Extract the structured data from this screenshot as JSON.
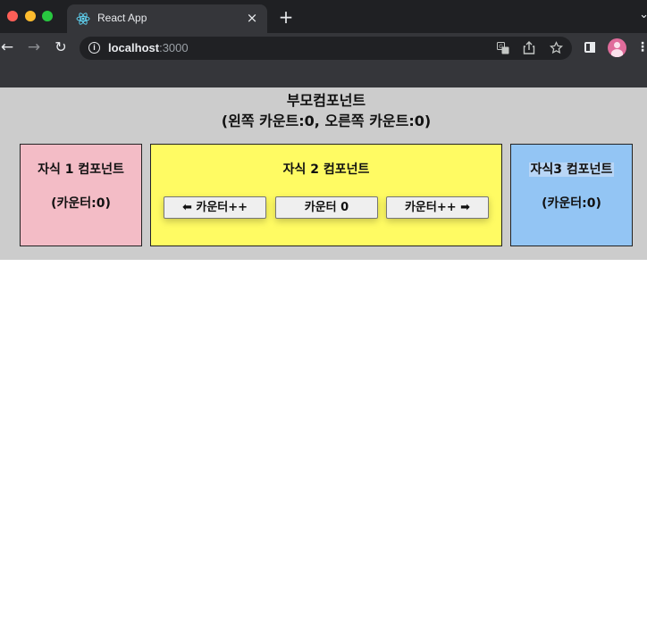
{
  "browser": {
    "tab_title": "React App",
    "tab_close": "×",
    "new_tab": "+",
    "tab_menu": "⌄",
    "nav_back": "←",
    "nav_forward": "→",
    "nav_reload": "↻",
    "url_host": "localhost",
    "url_port": ":3000",
    "info_glyph": "i"
  },
  "page": {
    "parent_title": "부모컴포넌트",
    "parent_counts": "(왼쪽 카운트:0, 오른쪽 카운트:0)",
    "child1": {
      "title": "자식 1 컴포넌트",
      "count": "(카운터:0)"
    },
    "child2": {
      "title": "자식 2 컴포넌트",
      "btn_left": "⬅ 카운터++",
      "btn_center": "카운터 0",
      "btn_right": "카운터++ ➡"
    },
    "child3": {
      "title": "자식3 컴포넌트",
      "count": "(카운터:0)"
    }
  },
  "colors": {
    "parent_bg": "#cccccc",
    "child1_bg": "#f3bcc6",
    "child2_bg": "#fffb63",
    "child3_bg": "#93c5f4"
  }
}
